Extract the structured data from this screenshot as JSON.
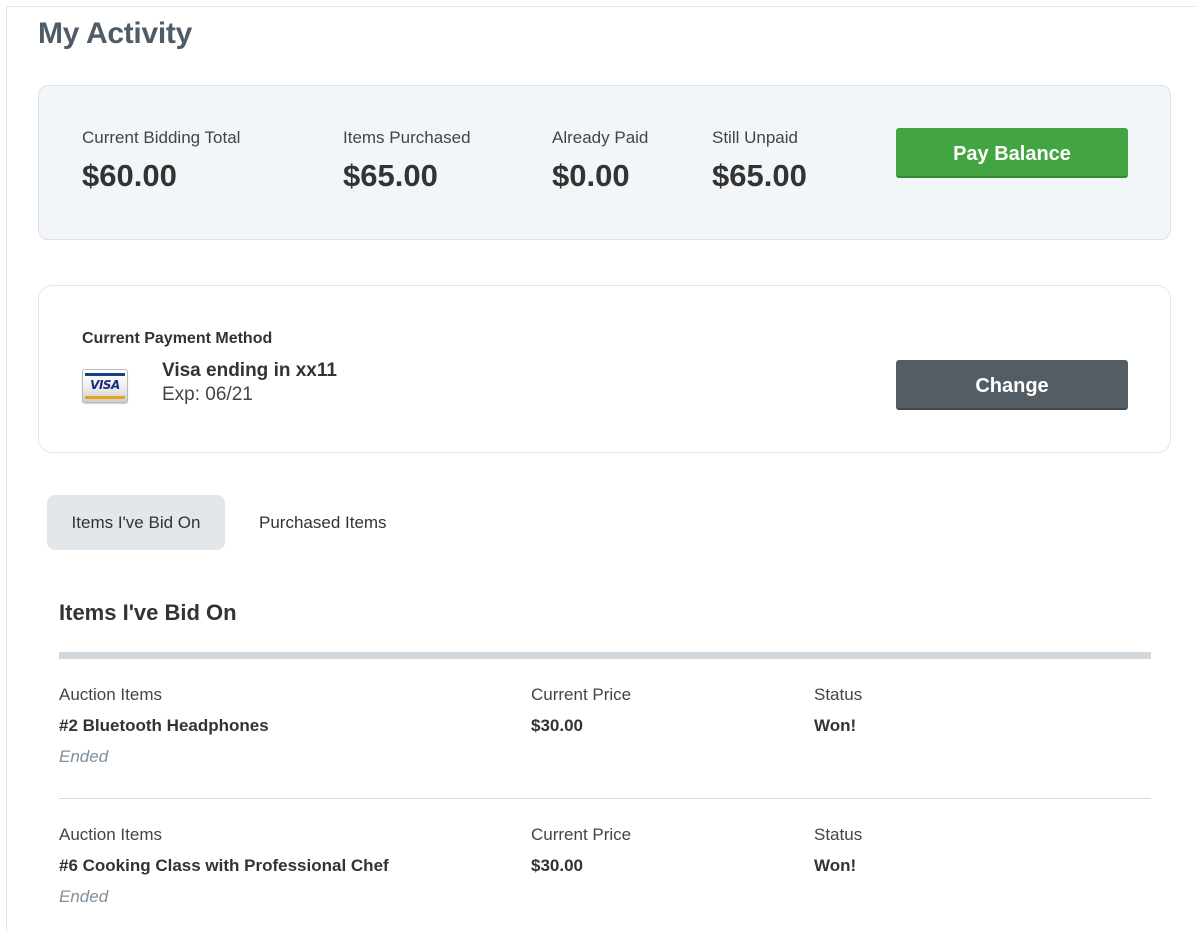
{
  "page": {
    "title": "My Activity"
  },
  "summary": {
    "current_bidding_total": {
      "label": "Current Bidding Total",
      "value": "$60.00"
    },
    "items_purchased": {
      "label": "Items Purchased",
      "value": "$65.00"
    },
    "already_paid": {
      "label": "Already Paid",
      "value": "$0.00"
    },
    "still_unpaid": {
      "label": "Still Unpaid",
      "value": "$65.00"
    },
    "pay_button_label": "Pay Balance"
  },
  "payment_method": {
    "heading": "Current Payment Method",
    "card_brand_icon": "visa-card-icon",
    "card_brand_text": "VISA",
    "card_name": "Visa ending in xx11",
    "expiration": "Exp: 06/21",
    "change_button_label": "Change"
  },
  "tabs": [
    {
      "label": "Items I've Bid On",
      "active": true
    },
    {
      "label": "Purchased Items",
      "active": false
    }
  ],
  "section": {
    "title": "Items I've Bid On",
    "columns": {
      "item": "Auction Items",
      "price": "Current Price",
      "status": "Status"
    },
    "rows": [
      {
        "name": "#2 Bluetooth Headphones",
        "state": "Ended",
        "price": "$30.00",
        "status": "Won!"
      },
      {
        "name": "#6 Cooking Class with Professional Chef",
        "state": "Ended",
        "price": "$30.00",
        "status": "Won!"
      }
    ]
  },
  "colors": {
    "pay_button": "#43a541",
    "change_button": "#545d64",
    "title": "#4f5b66",
    "summary_background": "#f3f6f8",
    "active_tab": "#e2e7eb",
    "ended_text": "#7f8f9c"
  }
}
